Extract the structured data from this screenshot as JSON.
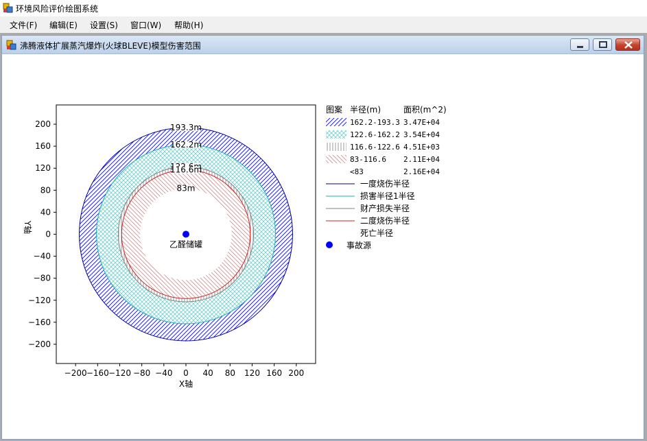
{
  "app": {
    "title": "环境风险评价绘图系统"
  },
  "menu": [
    {
      "label": "文件(F)"
    },
    {
      "label": "编辑(E)"
    },
    {
      "label": "设置(S)"
    },
    {
      "label": "窗口(W)"
    },
    {
      "label": "帮助(H)"
    }
  ],
  "child_window": {
    "title": "沸腾液体扩展蒸汽爆炸(火球BLEVE)模型伤害范围"
  },
  "colors": {
    "blue": "#0000ff",
    "darkblue": "#00008b",
    "cyan": "#20b2aa",
    "cyanfill": "#6fd0cc",
    "gray": "#808080",
    "red": "#cc2222",
    "redfill": "#f08080",
    "source": "#0000ff"
  },
  "chart_data": {
    "type": "scatter",
    "xlabel": "X轴",
    "ylabel": "Y轴",
    "xlim": [
      -235,
      235
    ],
    "ylim": [
      -235,
      235
    ],
    "xticks": [
      -200,
      -160,
      -120,
      -80,
      -40,
      0,
      40,
      80,
      120,
      160,
      200
    ],
    "yticks": [
      200,
      160,
      120,
      80,
      40,
      0,
      -40,
      -80,
      -120,
      -160,
      -200
    ],
    "circles": [
      {
        "radius": 193.3,
        "label": "193.3m"
      },
      {
        "radius": 162.2,
        "label": "162.2m"
      },
      {
        "radius": 122.6,
        "label": "122.6m"
      },
      {
        "radius": 116.6,
        "label": "116.6m"
      },
      {
        "radius": 83,
        "label": "83m"
      }
    ],
    "source": {
      "x": 0,
      "y": 0,
      "label": "乙醛储罐"
    },
    "legend": {
      "headers": [
        "图案",
        "半径(m)",
        "面积(m^2)"
      ],
      "rows": [
        {
          "range": "162.2-193.3",
          "area": "3.47E+04",
          "pattern": "blue-hatch"
        },
        {
          "range": "122.6-162.2",
          "area": "3.54E+04",
          "pattern": "cyan-cross"
        },
        {
          "range": "116.6-122.6",
          "area": "4.51E+03",
          "pattern": "gray-vertical"
        },
        {
          "range": "83-116.6",
          "area": "2.11E+04",
          "pattern": "red-hatch"
        },
        {
          "range": "<83",
          "area": "2.16E+04",
          "pattern": "none"
        }
      ],
      "lines": [
        {
          "label": "一度烧伤半径",
          "color": "blue"
        },
        {
          "label": "损害半径1半径",
          "color": "cyan"
        },
        {
          "label": "财产损失半径",
          "color": "gray"
        },
        {
          "label": "二度烧伤半径",
          "color": "red"
        },
        {
          "label": "死亡半径",
          "color": "none"
        }
      ],
      "source_label": "事故源"
    }
  }
}
